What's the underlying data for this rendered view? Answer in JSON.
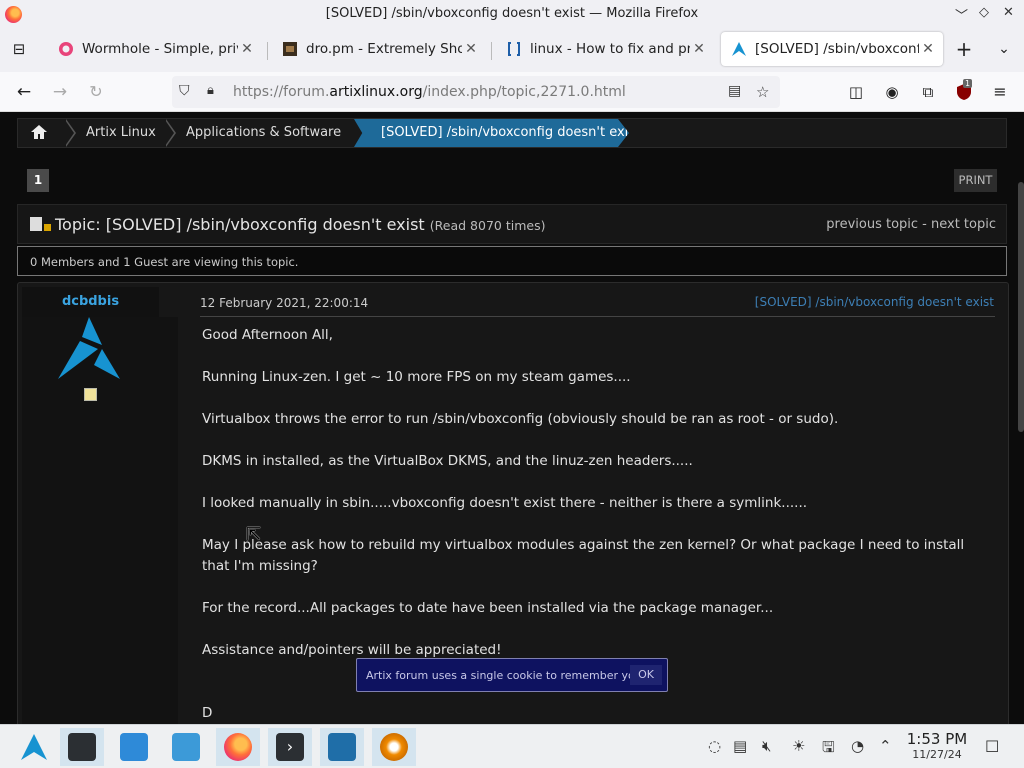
{
  "window": {
    "title": "[SOLVED] /sbin/vboxconfig doesn't exist — Mozilla Firefox"
  },
  "tabs": [
    {
      "label": "Wormhole - Simple, privat",
      "icon": "wormhole-icon",
      "active": false
    },
    {
      "label": "dro.pm - Extremely Short",
      "icon": "dropm-icon",
      "active": false
    },
    {
      "label": "linux - How to fix and prev",
      "icon": "stackexchange-icon",
      "active": false
    },
    {
      "label": "[SOLVED] /sbin/vboxconfig",
      "icon": "artix-icon",
      "active": true
    }
  ],
  "navbar": {
    "url_prefix": "https://forum.",
    "url_domain": "artixlinux.org",
    "url_path": "/index.php/topic,2271.0.html",
    "extension_badge": "1"
  },
  "breadcrumbs": {
    "items": [
      "Artix Linux",
      "Applications & Software"
    ],
    "current": "[SOLVED] /sbin/vboxconfig doesn't exist"
  },
  "pagination": {
    "current_page": "1",
    "print_label": "PRINT"
  },
  "topic": {
    "title": "Topic: [SOLVED] /sbin/vboxconfig doesn't exist",
    "reads": "(Read 8070 times)",
    "nav": "previous topic - next topic",
    "viewers": "0 Members and 1 Guest are viewing this topic."
  },
  "post": {
    "author": "dcbdbis",
    "date": "12 February 2021, 22:00:14",
    "subject": "[SOLVED] /sbin/vboxconfig doesn't exist",
    "paragraphs": [
      "Good Afternoon All,",
      "Running Linux-zen. I get ~ 10 more FPS on my steam games....",
      "Virtualbox throws the error to run /sbin/vboxconfig (obviously should be ran as root - or sudo).",
      "DKMS in installed, as the VirtualBox DKMS, and the linuz-zen headers.....",
      "I looked manually in sbin.....vboxconfig doesn't exist there - neither is there a symlink......",
      "May I please ask how to rebuild my virtualbox modules against the zen kernel? Or what package I need to install that I'm missing?",
      "For the record...All packages to date have been installed via the package manager...",
      "Assistance and/pointers will be appreciated!",
      "",
      "D"
    ]
  },
  "cookie_notice": {
    "message": "Artix forum uses a single cookie to remember you",
    "ok_label": "OK"
  },
  "taskbar": {
    "time": "1:53 PM",
    "date": "11/27/24"
  },
  "colors": {
    "accent": "#1e6a99",
    "author_link": "#3aa3e0",
    "page_bg": "#0c0c0c"
  }
}
